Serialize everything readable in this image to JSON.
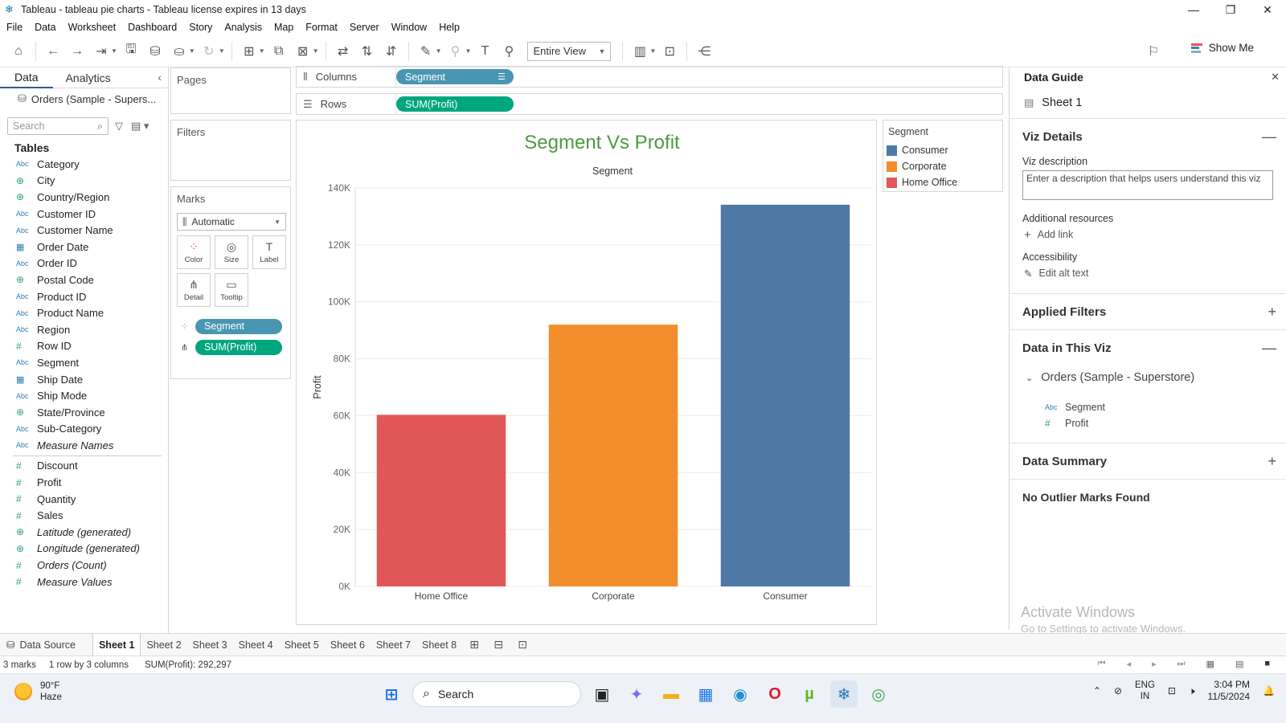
{
  "window": {
    "title": "Tableau - tableau pie charts - Tableau license expires in 13 days"
  },
  "menu": [
    "File",
    "Data",
    "Worksheet",
    "Dashboard",
    "Story",
    "Analysis",
    "Map",
    "Format",
    "Server",
    "Window",
    "Help"
  ],
  "toolbar": {
    "view_select": "Entire View",
    "show_me": "Show Me"
  },
  "data_pane": {
    "tabs": [
      "Data",
      "Analytics"
    ],
    "datasource": "Orders (Sample - Supers...",
    "search_placeholder": "Search",
    "tables_title": "Tables",
    "dimensions": [
      {
        "type": "Abc",
        "name": "Category"
      },
      {
        "type": "geo",
        "name": "City"
      },
      {
        "type": "geo",
        "name": "Country/Region"
      },
      {
        "type": "Abc",
        "name": "Customer ID"
      },
      {
        "type": "Abc",
        "name": "Customer Name"
      },
      {
        "type": "date",
        "name": "Order Date"
      },
      {
        "type": "Abc",
        "name": "Order ID"
      },
      {
        "type": "geo",
        "name": "Postal Code"
      },
      {
        "type": "Abc",
        "name": "Product ID"
      },
      {
        "type": "Abc",
        "name": "Product Name"
      },
      {
        "type": "Abc",
        "name": "Region"
      },
      {
        "type": "#",
        "name": "Row ID"
      },
      {
        "type": "Abc",
        "name": "Segment"
      },
      {
        "type": "date",
        "name": "Ship Date"
      },
      {
        "type": "Abc",
        "name": "Ship Mode"
      },
      {
        "type": "geo",
        "name": "State/Province"
      },
      {
        "type": "Abc",
        "name": "Sub-Category"
      },
      {
        "type": "Abc",
        "name": "Measure Names",
        "italic": true
      }
    ],
    "measures": [
      {
        "type": "#",
        "name": "Discount"
      },
      {
        "type": "#",
        "name": "Profit"
      },
      {
        "type": "#",
        "name": "Quantity"
      },
      {
        "type": "#",
        "name": "Sales"
      },
      {
        "type": "geo",
        "name": "Latitude (generated)",
        "italic": true
      },
      {
        "type": "geo",
        "name": "Longitude (generated)",
        "italic": true
      },
      {
        "type": "#",
        "name": "Orders (Count)",
        "italic": true
      },
      {
        "type": "#",
        "name": "Measure Values",
        "italic": true
      }
    ]
  },
  "cards": {
    "pages": "Pages",
    "filters": "Filters",
    "marks": "Marks",
    "marks_type": "Automatic",
    "mark_buttons": [
      "Color",
      "Size",
      "Label",
      "Detail",
      "Tooltip"
    ],
    "mark_pills": [
      "Segment",
      "SUM(Profit)"
    ]
  },
  "shelves": {
    "columns_label": "Columns",
    "columns_pill": "Segment",
    "rows_label": "Rows",
    "rows_pill": "SUM(Profit)"
  },
  "legend": {
    "title": "Segment",
    "items": [
      {
        "label": "Consumer",
        "color": "#4e79a7"
      },
      {
        "label": "Corporate",
        "color": "#f28e2b"
      },
      {
        "label": "Home Office",
        "color": "#e15759"
      }
    ]
  },
  "chart_data": {
    "type": "bar",
    "title": "Segment Vs Profit",
    "title_color": "#4a9a3f",
    "xlabel": "Segment",
    "ylabel": "Profit",
    "categories": [
      "Home Office",
      "Corporate",
      "Consumer"
    ],
    "values": [
      60299,
      91979,
      134119
    ],
    "colors": [
      "#e15759",
      "#f28e2b",
      "#4e79a7"
    ],
    "ylim": [
      0,
      140000
    ],
    "yticks": [
      0,
      20000,
      40000,
      60000,
      80000,
      100000,
      120000,
      140000
    ],
    "ytick_labels": [
      "0K",
      "20K",
      "40K",
      "60K",
      "80K",
      "100K",
      "120K",
      "140K"
    ],
    "grid": true,
    "legend": "right"
  },
  "data_guide": {
    "header": "Data Guide",
    "sheet": "Sheet 1",
    "viz_details": "Viz Details",
    "viz_description_label": "Viz description",
    "viz_description_placeholder": "Enter a description that helps users understand this viz",
    "additional_resources": "Additional resources",
    "add_link": "Add link",
    "accessibility": "Accessibility",
    "edit_alt_text": "Edit alt text",
    "applied_filters": "Applied Filters",
    "data_in_viz": "Data in This Viz",
    "datasource": "Orders (Sample - Superstore)",
    "fields": [
      {
        "type": "Abc",
        "name": "Segment"
      },
      {
        "type": "#",
        "name": "Profit"
      }
    ],
    "data_summary": "Data Summary",
    "no_outliers": "No Outlier Marks Found",
    "activate_title": "Activate Windows",
    "activate_sub": "Go to Settings to activate Windows."
  },
  "sheet_tabs": {
    "data_source": "Data Source",
    "sheets": [
      "Sheet 1",
      "Sheet 2",
      "Sheet 3",
      "Sheet 4",
      "Sheet 5",
      "Sheet 6",
      "Sheet 7",
      "Sheet 8"
    ],
    "active": "Sheet 1"
  },
  "status": {
    "marks": "3 marks",
    "layout": "1 row by 3 columns",
    "sum": "SUM(Profit): 292,297"
  },
  "taskbar": {
    "temp": "90°F",
    "weather": "Haze",
    "search": "Search",
    "lang_1": "ENG",
    "lang_2": "IN",
    "time": "3:04 PM",
    "date": "11/5/2024"
  }
}
